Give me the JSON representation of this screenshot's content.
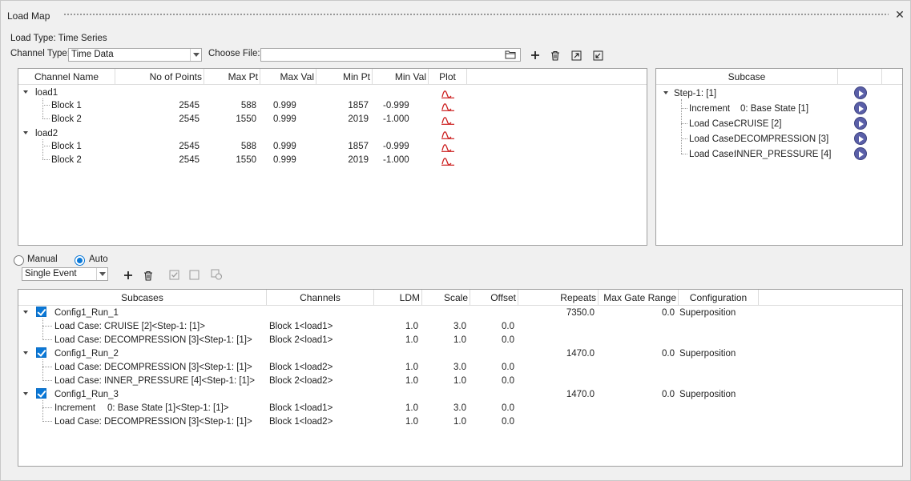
{
  "window": {
    "title": "Load Map"
  },
  "load_type": "Load Type: Time Series",
  "channel_type": {
    "label": "Channel Type:",
    "value": "Time Data"
  },
  "choose_file": {
    "label": "Choose File:",
    "value": ""
  },
  "channels_table": {
    "headers": [
      "Channel Name",
      "No of Points",
      "Max Pt",
      "Max Val",
      "Min Pt",
      "Min Val",
      "Plot"
    ],
    "groups": [
      {
        "name": "load1",
        "rows": [
          {
            "name": "Block 1",
            "points": "2545",
            "max_pt": "588",
            "max_val": "0.999",
            "min_pt": "1857",
            "min_val": "-0.999"
          },
          {
            "name": "Block 2",
            "points": "2545",
            "max_pt": "1550",
            "max_val": "0.999",
            "min_pt": "2019",
            "min_val": "-1.000"
          }
        ]
      },
      {
        "name": "load2",
        "rows": [
          {
            "name": "Block 1",
            "points": "2545",
            "max_pt": "588",
            "max_val": "0.999",
            "min_pt": "1857",
            "min_val": "-0.999"
          },
          {
            "name": "Block 2",
            "points": "2545",
            "max_pt": "1550",
            "max_val": "0.999",
            "min_pt": "2019",
            "min_val": "-1.000"
          }
        ]
      }
    ]
  },
  "subcase_tree": {
    "header": "Subcase",
    "root": "Step-1: [1]",
    "items": [
      {
        "type": "Increment",
        "name": "0: Base State [1]"
      },
      {
        "type": "Load Case:",
        "name": "CRUISE [2]"
      },
      {
        "type": "Load Case:",
        "name": "DECOMPRESSION [3]"
      },
      {
        "type": "Load Case:",
        "name": "INNER_PRESSURE [4]"
      }
    ]
  },
  "mode": {
    "manual": "Manual",
    "auto": "Auto",
    "selected": "Auto"
  },
  "event_type": "Single Event",
  "config_table": {
    "headers": [
      "Subcases",
      "Channels",
      "LDM",
      "Scale",
      "Offset",
      "Repeats",
      "Max Gate Range",
      "Configuration"
    ],
    "configs": [
      {
        "name": "Config1_Run_1",
        "repeats": "7350.0",
        "max_gate": "0.0",
        "configuration": "Superposition",
        "rows": [
          {
            "subcase": "Load Case: CRUISE [2]<Step-1: [1]>",
            "channel": "Block 1<load1>",
            "ldm": "1.0",
            "scale": "3.0",
            "offset": "0.0"
          },
          {
            "subcase": "Load Case: DECOMPRESSION [3]<Step-1: [1]>",
            "channel": "Block 2<load1>",
            "ldm": "1.0",
            "scale": "1.0",
            "offset": "0.0"
          }
        ]
      },
      {
        "name": "Config1_Run_2",
        "repeats": "1470.0",
        "max_gate": "0.0",
        "configuration": "Superposition",
        "rows": [
          {
            "subcase": "Load Case: DECOMPRESSION [3]<Step-1: [1]>",
            "channel": "Block 1<load2>",
            "ldm": "1.0",
            "scale": "3.0",
            "offset": "0.0"
          },
          {
            "subcase": "Load Case: INNER_PRESSURE [4]<Step-1: [1]>",
            "channel": "Block 2<load2>",
            "ldm": "1.0",
            "scale": "1.0",
            "offset": "0.0"
          }
        ]
      },
      {
        "name": "Config1_Run_3",
        "repeats": "1470.0",
        "max_gate": "0.0",
        "configuration": "Superposition",
        "rows": [
          {
            "subcase_type": "Increment",
            "subcase": "0: Base State [1]<Step-1: [1]>",
            "channel": "Block 1<load1>",
            "ldm": "1.0",
            "scale": "3.0",
            "offset": "0.0"
          },
          {
            "subcase": "Load Case: DECOMPRESSION [3]<Step-1: [1]>",
            "channel": "Block 1<load2>",
            "ldm": "1.0",
            "scale": "1.0",
            "offset": "0.0"
          }
        ]
      }
    ]
  },
  "colors": {
    "accent": "#0a78d7",
    "play": "#5a5fa8",
    "plot_icon": "#cc1f1f"
  }
}
